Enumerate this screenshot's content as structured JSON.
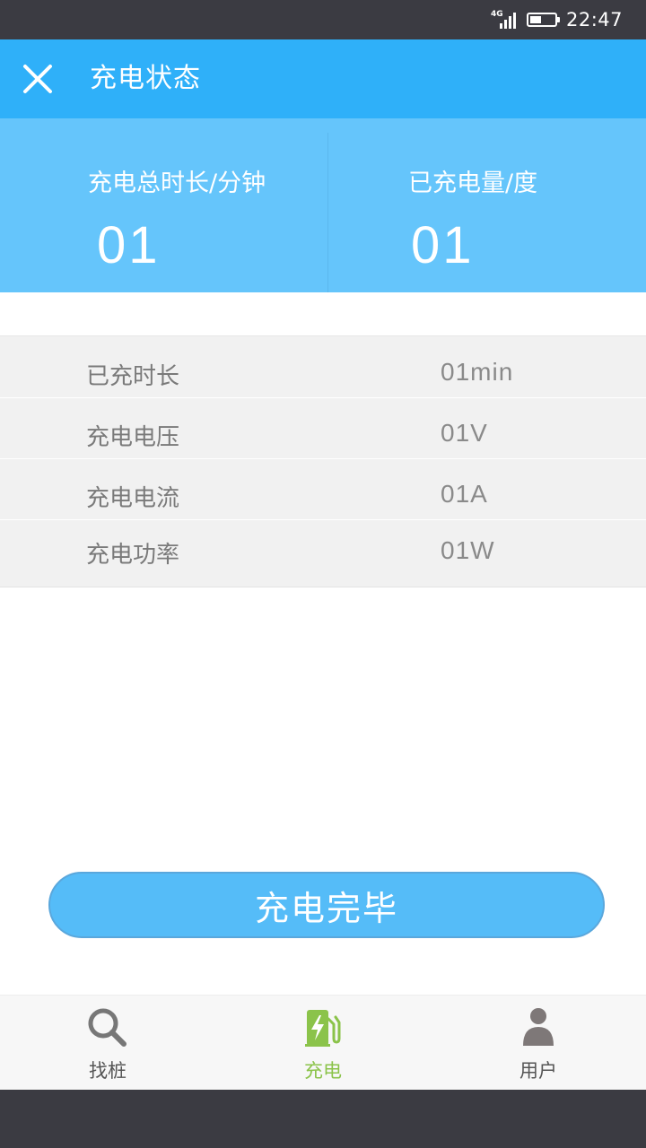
{
  "status_bar": {
    "network": "4G",
    "time": "22:47",
    "battery_level": 0.45
  },
  "header": {
    "title": "充电状态",
    "close_icon": "close-icon"
  },
  "summary": {
    "total_time": {
      "label": "充电总时长/分钟",
      "value": "01"
    },
    "energy": {
      "label": "已充电量/度",
      "value": "01"
    }
  },
  "details": [
    {
      "label": "已充时长",
      "value": "01min"
    },
    {
      "label": "充电电压",
      "value": "01V"
    },
    {
      "label": "充电电流",
      "value": "01A"
    },
    {
      "label": "充电功率",
      "value": "01W"
    }
  ],
  "finish_button": {
    "label": "充电完毕"
  },
  "bottom_nav": {
    "items": [
      {
        "label": "找桩",
        "icon": "search-icon",
        "active": false
      },
      {
        "label": "充电",
        "icon": "charging-station-icon",
        "active": true
      },
      {
        "label": "用户",
        "icon": "user-icon",
        "active": false
      }
    ]
  },
  "colors": {
    "header": "#2fb0f9",
    "summary": "#65c5fb",
    "active_nav": "#8bc34a",
    "button": "#55bcf8"
  }
}
